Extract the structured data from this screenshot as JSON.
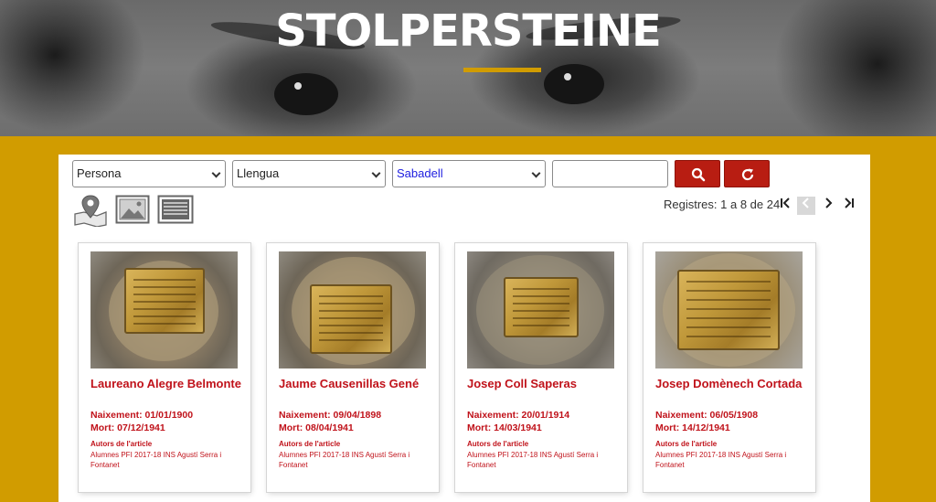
{
  "hero": {
    "title": "STOLPERSTEINE"
  },
  "filters": {
    "persona": "Persona",
    "llengua": "Llengua",
    "city": "Sabadell",
    "search_value": ""
  },
  "pagination": {
    "summary": "Registres: 1 a 8 de 24",
    "first": "|<",
    "prev": "<",
    "next": ">",
    "last": ">|"
  },
  "cards": [
    {
      "name": "Laureano Alegre Belmonte",
      "birth": "Naixement: 01/01/1900",
      "death": "Mort: 07/12/1941",
      "authors_label": "Autors de l'article",
      "authors": "Alumnes PFI 2017-18 INS Agustí Serra i Fontanet"
    },
    {
      "name": "Jaume Causenillas Gené",
      "birth": "Naixement: 09/04/1898",
      "death": "Mort: 08/04/1941",
      "authors_label": "Autors de l'article",
      "authors": "Alumnes PFI 2017-18 INS Agustí Serra i Fontanet"
    },
    {
      "name": "Josep Coll Saperas",
      "birth": "Naixement: 20/01/1914",
      "death": "Mort: 14/03/1941",
      "authors_label": "Autors de l'article",
      "authors": "Alumnes PFI 2017-18 INS Agustí Serra i Fontanet"
    },
    {
      "name": "Josep Domènech Cortada",
      "birth": "Naixement: 06/05/1908",
      "death": "Mort: 14/12/1941",
      "authors_label": "Autors de l'article",
      "authors": "Alumnes PFI 2017-18 INS Agustí Serra i Fontanet"
    }
  ]
}
